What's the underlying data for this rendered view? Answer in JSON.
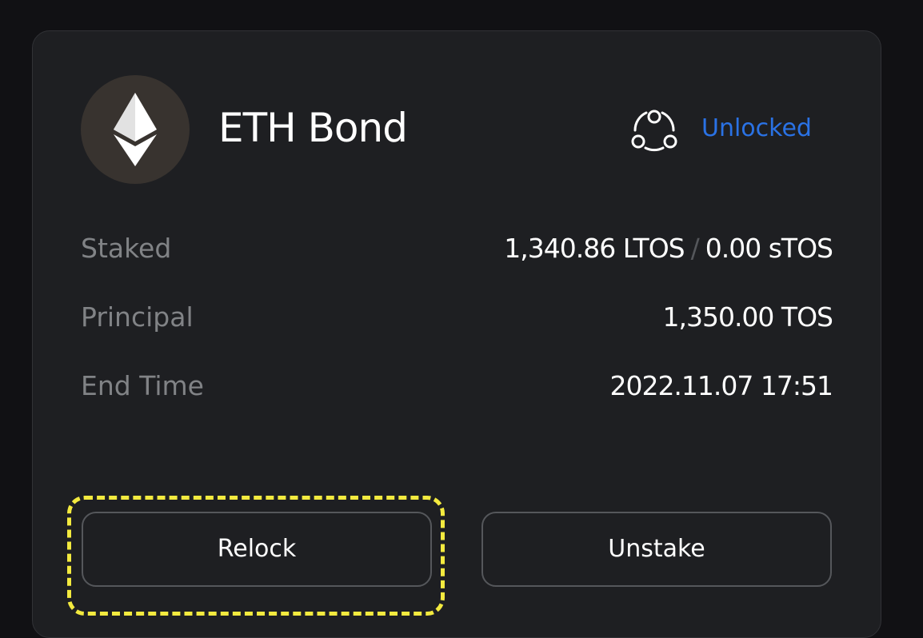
{
  "bond": {
    "title": "ETH Bond",
    "avatar_icon": "ethereum-icon",
    "status_icon": "network-icon",
    "status": "Unlocked",
    "status_color": "#2a72e5"
  },
  "details": {
    "staked_label": "Staked",
    "staked_ltos": "1,340.86 LTOS",
    "staked_separator": "/",
    "staked_stos": "0.00 sTOS",
    "principal_label": "Principal",
    "principal_value": "1,350.00 TOS",
    "end_time_label": "End Time",
    "end_time_value": "2022.11.07 17:51"
  },
  "actions": {
    "relock_label": "Relock",
    "unstake_label": "Unstake"
  },
  "highlight_color": "#f3ea3f"
}
